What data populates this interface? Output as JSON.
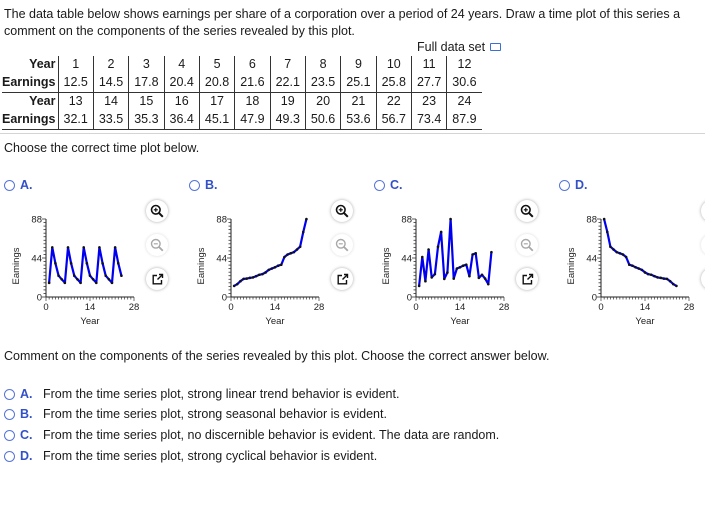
{
  "question": {
    "line1": "The data table below shows earnings per share of a corporation over a period of 24 years. Draw a time plot of this series a",
    "line2": "comment on the components of the series revealed by this plot."
  },
  "full_data_set": {
    "label": "Full data set",
    "icon": "popup-window-icon"
  },
  "table": {
    "row_label_year": "Year",
    "row_label_earnings": "Earnings",
    "blocks": [
      {
        "years": [
          "1",
          "2",
          "3",
          "4",
          "5",
          "6",
          "7",
          "8",
          "9",
          "10",
          "11",
          "12"
        ],
        "earnings": [
          "12.5",
          "14.5",
          "17.8",
          "20.4",
          "20.8",
          "21.6",
          "22.1",
          "23.5",
          "25.1",
          "25.8",
          "27.7",
          "30.6"
        ]
      },
      {
        "years": [
          "13",
          "14",
          "15",
          "16",
          "17",
          "18",
          "19",
          "20",
          "21",
          "22",
          "23",
          "24"
        ],
        "earnings": [
          "32.1",
          "33.5",
          "35.3",
          "36.4",
          "45.1",
          "47.9",
          "49.3",
          "50.6",
          "53.6",
          "56.7",
          "73.4",
          "87.9"
        ]
      }
    ]
  },
  "prompt_plot": "Choose the correct time plot below.",
  "plot_options": [
    {
      "letter": "A."
    },
    {
      "letter": "B."
    },
    {
      "letter": "C."
    },
    {
      "letter": "D."
    }
  ],
  "plot_buttons": {
    "zoom_in": "zoom-in-icon",
    "zoom_out": "zoom-out-icon",
    "popout": "popout-icon"
  },
  "chart_data": [
    {
      "type": "line",
      "option": "A",
      "xlabel": "Year",
      "ylabel": "Eamings",
      "xlim": [
        0,
        28
      ],
      "ylim": [
        0,
        88
      ],
      "xticks": [
        "0",
        "14",
        "28"
      ],
      "yticks": [
        "0",
        "44",
        "88"
      ],
      "x": [
        1,
        2,
        3,
        4,
        5,
        6,
        7,
        8,
        9,
        10,
        11,
        12,
        13,
        14,
        15,
        16,
        17,
        18,
        19,
        20,
        21,
        22,
        23,
        24
      ],
      "values": [
        16,
        56,
        38,
        24,
        20,
        16,
        56,
        38,
        24,
        20,
        16,
        56,
        38,
        24,
        20,
        16,
        56,
        38,
        24,
        20,
        16,
        56,
        38,
        24
      ]
    },
    {
      "type": "line",
      "option": "B",
      "xlabel": "Year",
      "ylabel": "Eamings",
      "xlim": [
        0,
        28
      ],
      "ylim": [
        0,
        88
      ],
      "xticks": [
        "0",
        "14",
        "28"
      ],
      "yticks": [
        "0",
        "44",
        "88"
      ],
      "x": [
        1,
        2,
        3,
        4,
        5,
        6,
        7,
        8,
        9,
        10,
        11,
        12,
        13,
        14,
        15,
        16,
        17,
        18,
        19,
        20,
        21,
        22,
        23,
        24
      ],
      "values": [
        12.5,
        14.5,
        17.8,
        20.4,
        20.8,
        21.6,
        22.1,
        23.5,
        25.1,
        25.8,
        27.7,
        30.6,
        32.1,
        33.5,
        35.3,
        36.4,
        45.1,
        47.9,
        49.3,
        50.6,
        53.6,
        56.7,
        73.4,
        87.9
      ]
    },
    {
      "type": "line",
      "option": "C",
      "xlabel": "Year",
      "ylabel": "Eamings",
      "xlim": [
        0,
        28
      ],
      "ylim": [
        0,
        88
      ],
      "xticks": [
        "0",
        "14",
        "28"
      ],
      "yticks": [
        "0",
        "44",
        "88"
      ],
      "x": [
        1,
        2,
        3,
        4,
        5,
        6,
        7,
        8,
        9,
        10,
        11,
        12,
        13,
        14,
        15,
        16,
        17,
        18,
        19,
        20,
        21,
        22,
        23,
        24
      ],
      "values": [
        12.5,
        45.1,
        17.8,
        53.6,
        22.1,
        25.8,
        56.7,
        73.4,
        20.4,
        27.7,
        87.9,
        20.8,
        32.1,
        33.5,
        35.3,
        36.4,
        23.5,
        47.9,
        49.3,
        21.6,
        25.1,
        20.8,
        14.5,
        50.6
      ]
    },
    {
      "type": "line",
      "option": "D",
      "xlabel": "Year",
      "ylabel": "Eamings",
      "xlim": [
        0,
        28
      ],
      "ylim": [
        0,
        88
      ],
      "xticks": [
        "0",
        "14",
        "28"
      ],
      "yticks": [
        "0",
        "44",
        "88"
      ],
      "x": [
        1,
        2,
        3,
        4,
        5,
        6,
        7,
        8,
        9,
        10,
        11,
        12,
        13,
        14,
        15,
        16,
        17,
        18,
        19,
        20,
        21,
        22,
        23,
        24
      ],
      "values": [
        87.9,
        73.4,
        56.7,
        53.6,
        50.6,
        49.3,
        47.9,
        45.1,
        36.4,
        35.3,
        33.5,
        32.1,
        30.6,
        27.7,
        25.8,
        25.1,
        23.5,
        22.1,
        21.6,
        20.8,
        20.4,
        17.8,
        14.5,
        12.5
      ]
    }
  ],
  "prompt_components": "Comment on the components of the series revealed by this plot. Choose the correct answer below.",
  "answers": [
    {
      "letter": "A.",
      "text": "From the time series plot, strong linear trend behavior is evident."
    },
    {
      "letter": "B.",
      "text": "From the time series plot, strong seasonal behavior is evident."
    },
    {
      "letter": "C.",
      "text": "From the time series plot, no discernible behavior is evident. The data are random."
    },
    {
      "letter": "D.",
      "text": "From the time series plot, strong cyclical behavior is evident."
    }
  ],
  "colors": {
    "accent": "#3350c8",
    "line": "#0000ee",
    "point": "#111111"
  }
}
